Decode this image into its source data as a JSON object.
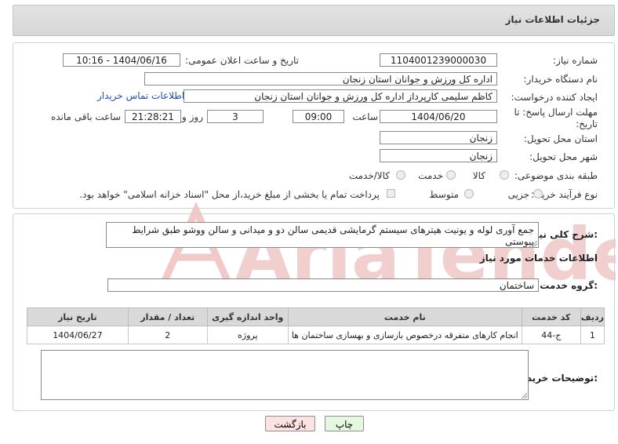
{
  "header": {
    "title": "جزئیات اطلاعات نیاز"
  },
  "fields": {
    "need_number_label": "شماره نیاز:",
    "need_number": "1104001239000030",
    "announce_label": "تاریخ و ساعت اعلان عمومی:",
    "announce_value": "1404/06/16 - 10:16",
    "buyer_org_label": "نام دستگاه خریدار:",
    "buyer_org": "اداره کل ورزش و جوانان استان زنجان",
    "requester_label": "ایجاد کننده درخواست:",
    "requester": "کاظم سلیمی کارپرداز اداره کل ورزش و جوانان استان زنجان",
    "contact_link": "اطلاعات تماس خریدار",
    "deadline_label_1": "مهلت ارسال پاسخ: تا",
    "deadline_label_2": "تاریخ:",
    "deadline_date": "1404/06/20",
    "hour_label": "ساعت",
    "deadline_time": "09:00",
    "days_value": "3",
    "days_label": "روز و",
    "remaining_time": "21:28:21",
    "remaining_label": "ساعت باقی مانده",
    "province_label": "استان محل تحویل:",
    "province": "زنجان",
    "city_label": "شهر محل تحویل:",
    "city": "زنجان",
    "category_label": "طبقه بندی موضوعی:",
    "category_goods": "کالا",
    "category_service": "خدمت",
    "category_both": "کالا/خدمت",
    "process_label": "نوع فرآیند خرید :",
    "process_minor": "جزیی",
    "process_medium": "متوسط",
    "payment_note": "پرداخت تمام یا بخشی از مبلغ خرید،از محل \"اسناد خزانه اسلامی\" خواهد بود."
  },
  "summary": {
    "label": "شرح کلی نیاز:",
    "text": "جمع آوری لوله و یونیت هیترهای سیستم گرمایشی قدیمی سالن دو و میدانی و سالن ووشو طبق شرایط پیوستی"
  },
  "services": {
    "section_title": "اطلاعات خدمات مورد نیاز",
    "group_label": "گروه خدمت:",
    "group_value": "ساختمان",
    "columns": [
      "ردیف",
      "کد خدمت",
      "نام خدمت",
      "واحد اندازه گیری",
      "تعداد / مقدار",
      "تاریخ نیاز"
    ],
    "rows": [
      [
        "1",
        "ج-44",
        "انجام کارهای متفرقه درخصوص بازسازی و بهسازی ساختمان ها",
        "پروژه",
        "2",
        "1404/06/27"
      ]
    ]
  },
  "buyer_notes": {
    "label": "توضیحات خریدار:"
  },
  "buttons": {
    "print": "چاپ",
    "back": "بازگشت"
  },
  "watermark": {
    "text": "AriaTender.net"
  },
  "colors": {
    "link": "#1a4fb3",
    "back_button_bg": "#fde2e2",
    "print_button_bg": "#e4f8e0",
    "header_bg": "#dcdcdc"
  }
}
